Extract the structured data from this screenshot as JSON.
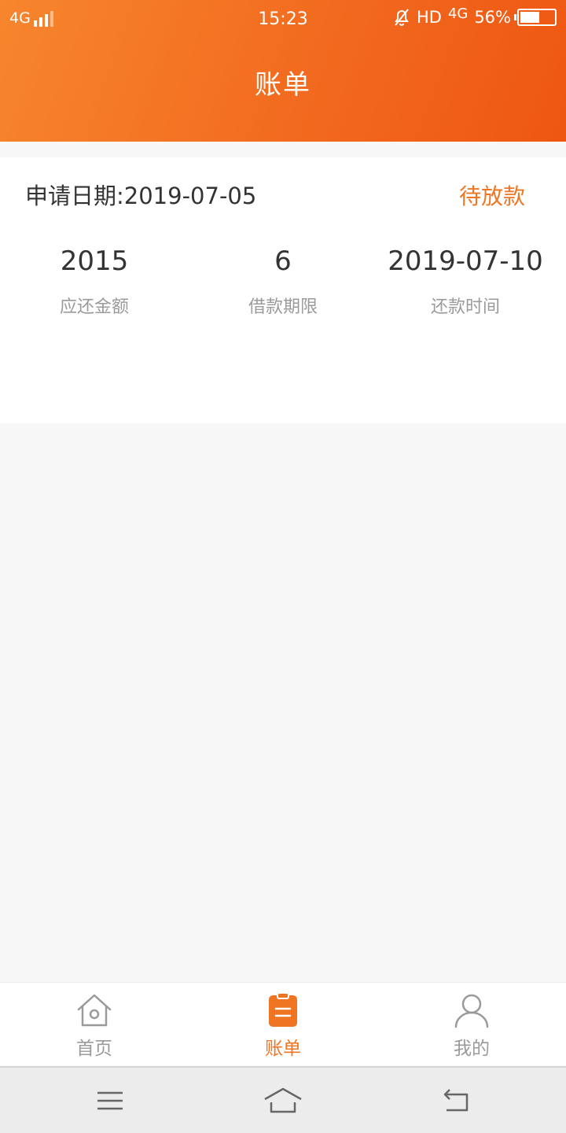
{
  "status_bar": {
    "network_left": "4G",
    "time": "15:23",
    "hd": "HD",
    "network_right": "4G",
    "battery_pct": "56%"
  },
  "header": {
    "title": "账单"
  },
  "bill": {
    "apply_date": "申请日期:2019-07-05",
    "status": "待放款",
    "stats": [
      {
        "value": "2015",
        "label": "应还金额"
      },
      {
        "value": "6",
        "label": "借款期限"
      },
      {
        "value": "2019-07-10",
        "label": "还款时间"
      }
    ]
  },
  "tabbar": {
    "items": [
      {
        "label": "首页",
        "icon": "home-icon"
      },
      {
        "label": "账单",
        "icon": "bill-icon",
        "active": true
      },
      {
        "label": "我的",
        "icon": "user-icon"
      }
    ]
  },
  "colors": {
    "accent": "#f07522",
    "header_start": "#f7862d",
    "header_end": "#ee5612"
  }
}
